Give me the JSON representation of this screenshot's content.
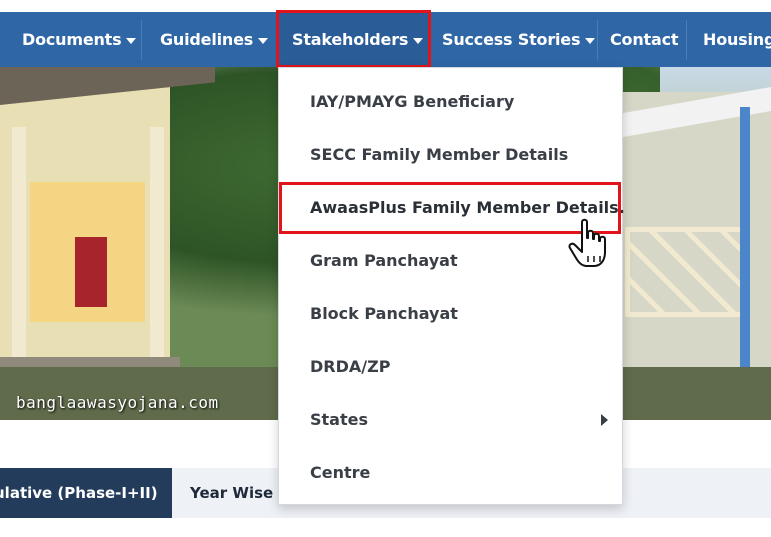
{
  "nav": {
    "items": [
      {
        "label": "Documents",
        "caret": true
      },
      {
        "label": "Guidelines",
        "caret": true
      },
      {
        "label": "Stakeholders",
        "caret": true
      },
      {
        "label": "Success Stories",
        "caret": true
      },
      {
        "label": "Contact",
        "caret": false
      },
      {
        "label": "Housing",
        "caret": false
      }
    ]
  },
  "hero": {
    "watermark": "banglaawasyojana.com"
  },
  "stakeholders_menu": {
    "items": [
      {
        "label": "IAY/PMAYG Beneficiary"
      },
      {
        "label": "SECC Family Member Details"
      },
      {
        "label": "AwaasPlus Family Member Details."
      },
      {
        "label": "Gram Panchayat"
      },
      {
        "label": "Block Panchayat"
      },
      {
        "label": "DRDA/ZP"
      },
      {
        "label": "States",
        "submenu_icon": "chevron-right-icon"
      },
      {
        "label": "Centre"
      }
    ]
  },
  "tabs": {
    "active_label": "ulative (Phase-I+II)",
    "inactive_label": "Year Wise I"
  },
  "colors": {
    "nav_bg": "#2f66a6",
    "highlight_border": "#e0141a",
    "active_tab_bg": "#243c5c"
  },
  "cursor_icon": "hand-pointer-icon"
}
